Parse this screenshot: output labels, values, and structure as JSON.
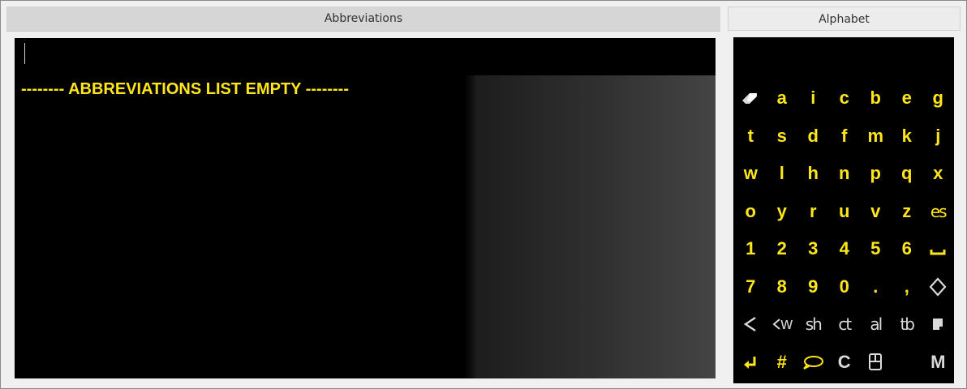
{
  "headers": {
    "abbreviations": "Abbreviations",
    "alphabet": "Alphabet"
  },
  "abbreviations": {
    "input_value": "",
    "empty_message": "-------- ABBREVIATIONS LIST EMPTY --------"
  },
  "keys": {
    "r1": [
      "a",
      "i",
      "c",
      "b",
      "e",
      "g"
    ],
    "r2": [
      "t",
      "s",
      "d",
      "f",
      "m",
      "k",
      "j"
    ],
    "r3": [
      "w",
      "l",
      "h",
      "n",
      "p",
      "q",
      "x"
    ],
    "r4": [
      "o",
      "y",
      "r",
      "u",
      "v",
      "z",
      "es"
    ],
    "r5": [
      "1",
      "2",
      "3",
      "4",
      "5",
      "6"
    ],
    "r6": [
      "7",
      "8",
      "9",
      "0",
      ".",
      ","
    ],
    "r7": [
      "w",
      "sh",
      "ct",
      "al",
      "tb"
    ],
    "r8": [
      "#",
      "C",
      "M"
    ]
  },
  "icons": {
    "eraser": "eraser-icon",
    "space": "space-icon",
    "diamond": "diamond-icon",
    "back": "back-arrow-icon",
    "back_w": "back-w-icon",
    "note": "note-icon",
    "enter": "enter-icon",
    "speech": "speech-bubble-icon",
    "mouse": "mouse-icon"
  },
  "colors": {
    "key_text": "#ffe61a",
    "special_key_text": "#d9d9d9",
    "background": "#000000"
  }
}
